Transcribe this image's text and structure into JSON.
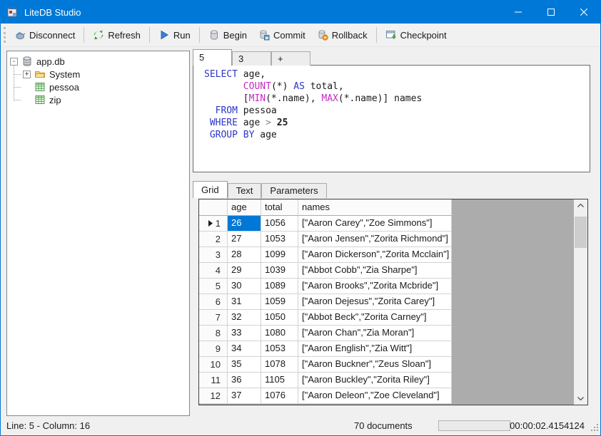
{
  "window": {
    "title": "LiteDB Studio"
  },
  "titlebar": {
    "controls": [
      "minimize",
      "maximize",
      "close"
    ]
  },
  "toolbar": {
    "groups": [
      {
        "items": [
          {
            "label": "Disconnect",
            "icon": "disconnect-icon"
          }
        ]
      },
      {
        "items": [
          {
            "label": "Refresh",
            "icon": "refresh-icon"
          }
        ]
      },
      {
        "items": [
          {
            "label": "Run",
            "icon": "run-icon"
          }
        ]
      },
      {
        "items": [
          {
            "label": "Begin",
            "icon": "begin-icon"
          },
          {
            "label": "Commit",
            "icon": "commit-icon"
          },
          {
            "label": "Rollback",
            "icon": "rollback-icon"
          }
        ]
      },
      {
        "items": [
          {
            "label": "Checkpoint",
            "icon": "checkpoint-icon"
          }
        ]
      }
    ]
  },
  "sidebar": {
    "tree": [
      {
        "label": "app.db",
        "icon": "database-icon",
        "expander": "-",
        "indent": 0
      },
      {
        "label": "System",
        "icon": "folder-icon",
        "expander": "+",
        "indent": 1
      },
      {
        "label": "pessoa",
        "icon": "table-icon",
        "indent": 1
      },
      {
        "label": "zip",
        "icon": "table-icon",
        "indent": 1
      }
    ]
  },
  "editor": {
    "tabs": [
      {
        "label": "5",
        "active": true
      },
      {
        "label": "3",
        "active": false
      },
      {
        "label": "+",
        "active": false
      }
    ],
    "sql_lines": [
      [
        {
          "t": "SELECT",
          "c": "kw"
        },
        {
          "t": " age,",
          "c": "pl"
        }
      ],
      [
        {
          "t": "       ",
          "c": "pl"
        },
        {
          "t": "COUNT",
          "c": "fn"
        },
        {
          "t": "(*) ",
          "c": "pl"
        },
        {
          "t": "AS",
          "c": "kw"
        },
        {
          "t": " total,",
          "c": "pl"
        }
      ],
      [
        {
          "t": "       [",
          "c": "pl"
        },
        {
          "t": "MIN",
          "c": "fn"
        },
        {
          "t": "(*.name), ",
          "c": "pl"
        },
        {
          "t": "MAX",
          "c": "fn"
        },
        {
          "t": "(*.name)] names",
          "c": "pl"
        }
      ],
      [
        {
          "t": "  ",
          "c": "pl"
        },
        {
          "t": "FROM",
          "c": "kw"
        },
        {
          "t": " pessoa",
          "c": "pl"
        }
      ],
      [
        {
          "t": " ",
          "c": "pl"
        },
        {
          "t": "WHERE",
          "c": "kw"
        },
        {
          "t": " age ",
          "c": "pl"
        },
        {
          "t": ">",
          "c": "op"
        },
        {
          "t": " ",
          "c": "pl"
        },
        {
          "t": "25",
          "c": "num"
        }
      ],
      [
        {
          "t": " ",
          "c": "pl"
        },
        {
          "t": "GROUP BY",
          "c": "kw"
        },
        {
          "t": " age",
          "c": "pl"
        }
      ]
    ]
  },
  "results": {
    "tabs": [
      {
        "label": "Grid",
        "active": true
      },
      {
        "label": "Text",
        "active": false
      },
      {
        "label": "Parameters",
        "active": false
      }
    ],
    "grid": {
      "columns": [
        "age",
        "total",
        "names"
      ],
      "rows": [
        {
          "n": "1",
          "age": "26",
          "total": "1056",
          "names": "[\"Aaron Carey\",\"Zoe Simmons\"]",
          "selected": true
        },
        {
          "n": "2",
          "age": "27",
          "total": "1053",
          "names": "[\"Aaron Jensen\",\"Zorita Richmond\"]"
        },
        {
          "n": "3",
          "age": "28",
          "total": "1099",
          "names": "[\"Aaron Dickerson\",\"Zorita Mcclain\"]"
        },
        {
          "n": "4",
          "age": "29",
          "total": "1039",
          "names": "[\"Abbot Cobb\",\"Zia Sharpe\"]"
        },
        {
          "n": "5",
          "age": "30",
          "total": "1089",
          "names": "[\"Aaron Brooks\",\"Zorita Mcbride\"]"
        },
        {
          "n": "6",
          "age": "31",
          "total": "1059",
          "names": "[\"Aaron Dejesus\",\"Zorita Carey\"]"
        },
        {
          "n": "7",
          "age": "32",
          "total": "1050",
          "names": "[\"Abbot Beck\",\"Zorita Carney\"]"
        },
        {
          "n": "8",
          "age": "33",
          "total": "1080",
          "names": "[\"Aaron Chan\",\"Zia Moran\"]"
        },
        {
          "n": "9",
          "age": "34",
          "total": "1053",
          "names": "[\"Aaron English\",\"Zia Witt\"]"
        },
        {
          "n": "10",
          "age": "35",
          "total": "1078",
          "names": "[\"Aaron Buckner\",\"Zeus Sloan\"]"
        },
        {
          "n": "11",
          "age": "36",
          "total": "1105",
          "names": "[\"Aaron Buckley\",\"Zorita Riley\"]"
        },
        {
          "n": "12",
          "age": "37",
          "total": "1076",
          "names": "[\"Aaron Deleon\",\"Zoe Cleveland\"]"
        }
      ]
    }
  },
  "status": {
    "line_col": "Line: 5 - Column: 16",
    "documents": "70 documents",
    "elapsed": "00:00:02.4154124"
  },
  "colors": {
    "accent": "#0078D7",
    "selection": "#0078D7",
    "keyword": "#2B36C8",
    "function": "#C42BC4",
    "operator": "#838383",
    "grid_empty": "#ACACAC"
  }
}
